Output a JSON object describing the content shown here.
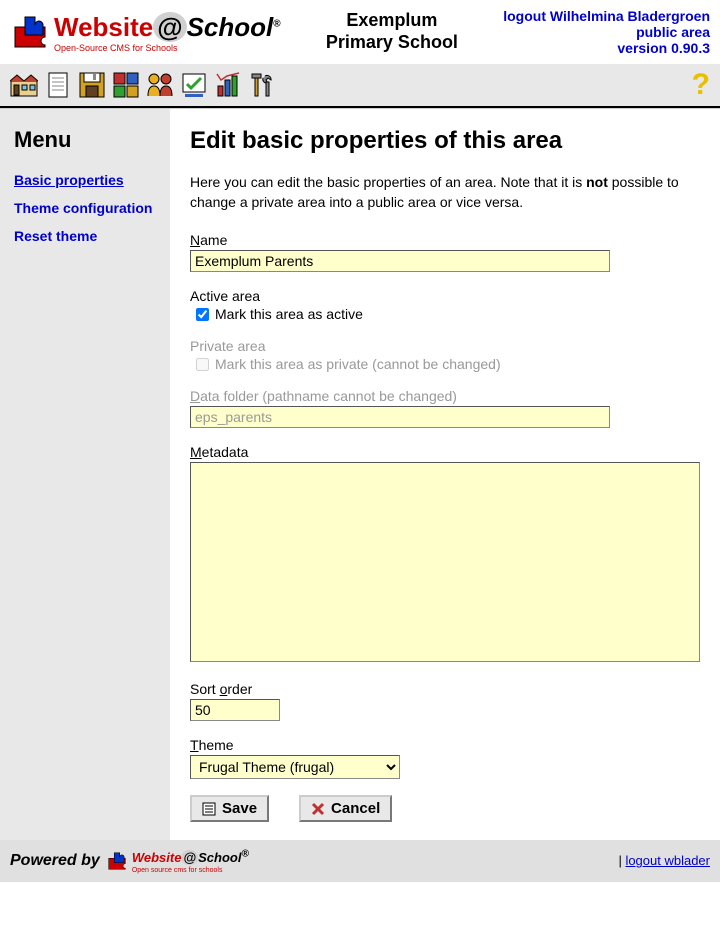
{
  "header": {
    "logo_main": "Website",
    "logo_at": "@",
    "logo_school": "School",
    "logo_sub": "Open-Source CMS for Schools",
    "school_line1": "Exemplum",
    "school_line2": "Primary School",
    "logout_label": "logout Wilhelmina Bladergroen",
    "area_label": "public area",
    "version_label": "version 0.90.3"
  },
  "sidebar": {
    "title": "Menu",
    "items": [
      {
        "label": "Basic properties"
      },
      {
        "label": "Theme configuration"
      },
      {
        "label": "Reset theme"
      }
    ]
  },
  "content": {
    "title": "Edit basic properties of this area",
    "intro_before": "Here you can edit the basic properties of an area. Note that it is ",
    "intro_bold": "not",
    "intro_after": " possible to change a private area into a public area or vice versa.",
    "name_label_u": "N",
    "name_label_rest": "ame",
    "name_value": "Exemplum Parents",
    "active_label": "Active area",
    "active_check_before": "Mark this area as ",
    "active_check_u": "a",
    "active_check_after": "ctive",
    "private_label": "Private area",
    "private_check_before": "Mark this area as ",
    "private_check_u": "p",
    "private_check_after": "rivate (cannot be changed)",
    "folder_label_u": "D",
    "folder_label_rest": "ata folder (pathname cannot be changed)",
    "folder_value": "eps_parents",
    "metadata_label_u": "M",
    "metadata_label_rest": "etadata",
    "metadata_value": "",
    "sort_label_before": "Sort ",
    "sort_label_u": "o",
    "sort_label_after": "rder",
    "sort_value": "50",
    "theme_label_u": "T",
    "theme_label_rest": "heme",
    "theme_value": "Frugal Theme (frugal)",
    "save_label": "Save",
    "cancel_label": "Cancel"
  },
  "footer": {
    "powered": "Powered by",
    "logo_main": "Website",
    "logo_at": "@",
    "logo_school": "School",
    "logo_sub": "Open source cms for schools",
    "sep": " | ",
    "logout_link": "logout wblader"
  }
}
